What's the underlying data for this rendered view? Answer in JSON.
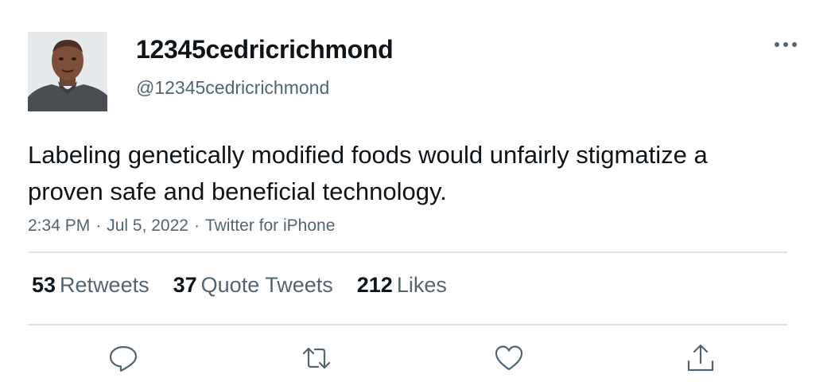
{
  "user": {
    "display_name": "12345cedricrichmond",
    "handle": "@12345cedricrichmond",
    "avatar_icon": "profile-photo"
  },
  "tweet": {
    "text": "Labeling genetically modified foods would unfairly stigmatize a proven safe and beneficial technology.",
    "time": "2:34 PM",
    "date": "Jul 5, 2022",
    "source": "Twitter for iPhone",
    "separator": "·"
  },
  "stats": {
    "retweets_count": "53",
    "retweets_label": "Retweets",
    "quotes_count": "37",
    "quotes_label": "Quote Tweets",
    "likes_count": "212",
    "likes_label": "Likes"
  },
  "actions": {
    "reply_icon": "reply-icon",
    "retweet_icon": "retweet-icon",
    "like_icon": "like-icon",
    "share_icon": "share-icon"
  },
  "colors": {
    "text_primary": "#0f1419",
    "text_secondary": "#536471",
    "divider": "#dde3e7"
  }
}
